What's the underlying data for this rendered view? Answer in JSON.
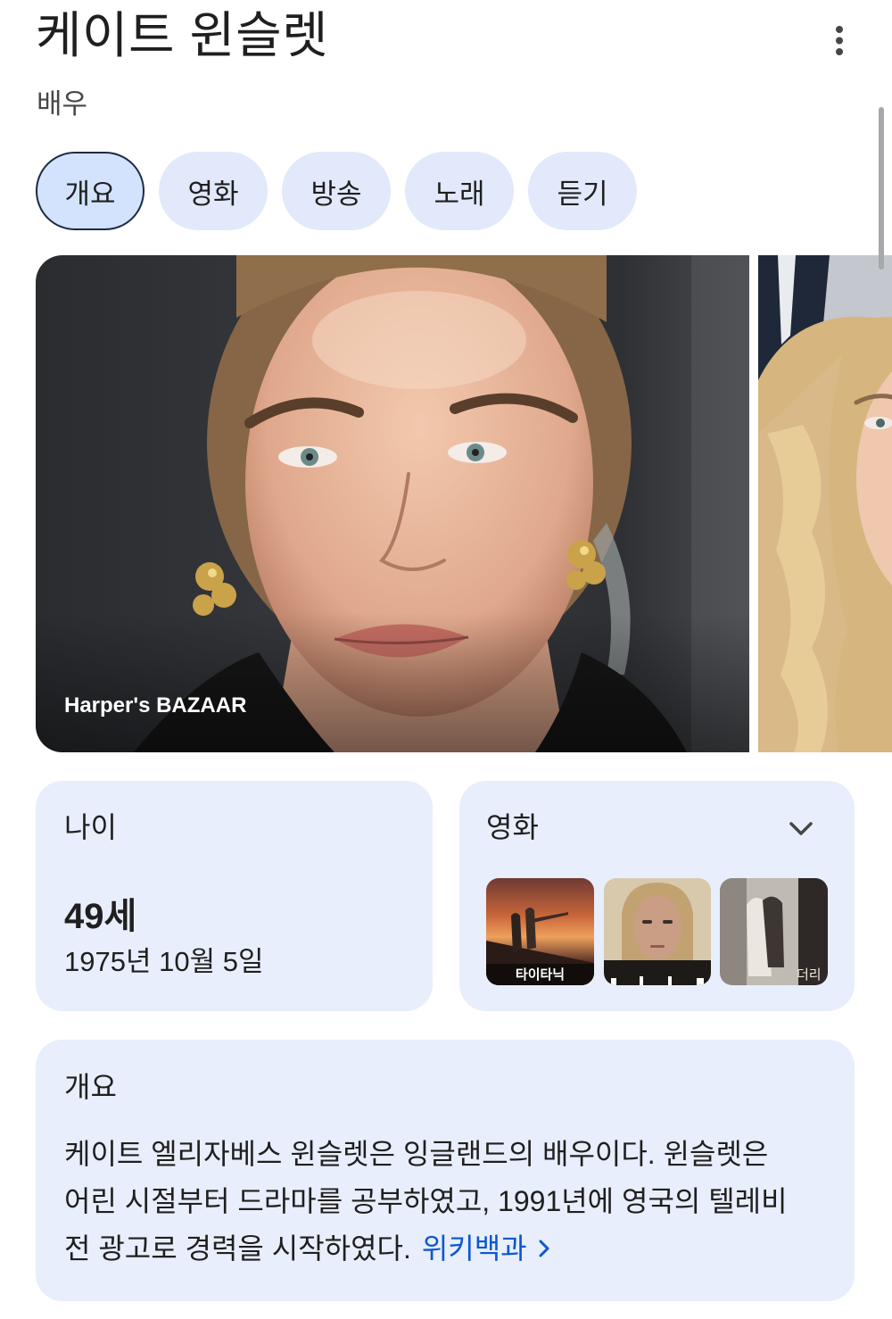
{
  "header": {
    "title": "케이트 윈슬렛",
    "subtitle": "배우"
  },
  "tabs": [
    {
      "label": "개요",
      "selected": true
    },
    {
      "label": "영화",
      "selected": false
    },
    {
      "label": "방송",
      "selected": false
    },
    {
      "label": "노래",
      "selected": false
    },
    {
      "label": "듣기",
      "selected": false
    }
  ],
  "image_carousel": {
    "items": [
      {
        "source": "Harper's BAZAAR"
      },
      {}
    ]
  },
  "age_card": {
    "label": "나이",
    "age": "49세",
    "birth_date": "1975년 10월 5일"
  },
  "movies": {
    "label": "영화",
    "posters": [
      {
        "title": "타이타닉"
      },
      {},
      {
        "title": "더리"
      }
    ]
  },
  "overview": {
    "heading": "개요",
    "lines": [
      "케이트 엘리자베스 윈슬렛은 잉글랜드의 배우이다. 윈슬렛은",
      "어린 시절부터 드라마를 공부하였고, 1991년에 영국의 텔레비",
      "전 광고로 경력을 시작하였다."
    ],
    "source_label": "위키백과"
  },
  "icons": {
    "menu": "more-vert-icon",
    "movies_expand": "chevron-down-icon",
    "source_link": "chevron-right-icon"
  },
  "colors": {
    "text": "#1f1f1f",
    "secondary_text": "#474747",
    "chip_background": "#e1e9fa",
    "chip_selected_background": "#d3e3fd",
    "chip_selected_border": "#1c2a44",
    "card_background": "#e8eefb",
    "link": "#0b57d0"
  }
}
